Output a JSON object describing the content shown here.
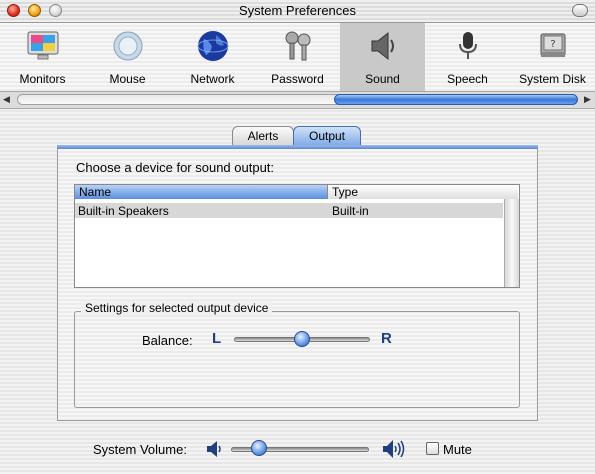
{
  "window": {
    "title": "System Preferences"
  },
  "toolbar": {
    "items": [
      {
        "label": "Monitors",
        "icon": "monitor-icon"
      },
      {
        "label": "Mouse",
        "icon": "mouse-icon"
      },
      {
        "label": "Network",
        "icon": "globe-icon"
      },
      {
        "label": "Password",
        "icon": "keys-icon"
      },
      {
        "label": "Sound",
        "icon": "speaker-icon",
        "selected": true
      },
      {
        "label": "Speech",
        "icon": "microphone-icon"
      },
      {
        "label": "System Disk",
        "icon": "disk-icon"
      }
    ]
  },
  "tabs": [
    {
      "label": "Alerts",
      "selected": false
    },
    {
      "label": "Output",
      "selected": true
    }
  ],
  "output": {
    "choose_label": "Choose a device for sound output:",
    "columns": [
      "Name",
      "Type"
    ],
    "rows": [
      {
        "name": "Built-in Speakers",
        "type": "Built-in"
      }
    ],
    "settings_label": "Settings for selected output device",
    "balance_label": "Balance:",
    "balance_left": "L",
    "balance_right": "R",
    "balance_value": 0.5
  },
  "volume": {
    "label": "System Volume:",
    "value": 0.2,
    "mute_label": "Mute",
    "muted": false
  },
  "colors": {
    "accent": "#5a8ede",
    "selection": "#d7d7d7"
  }
}
